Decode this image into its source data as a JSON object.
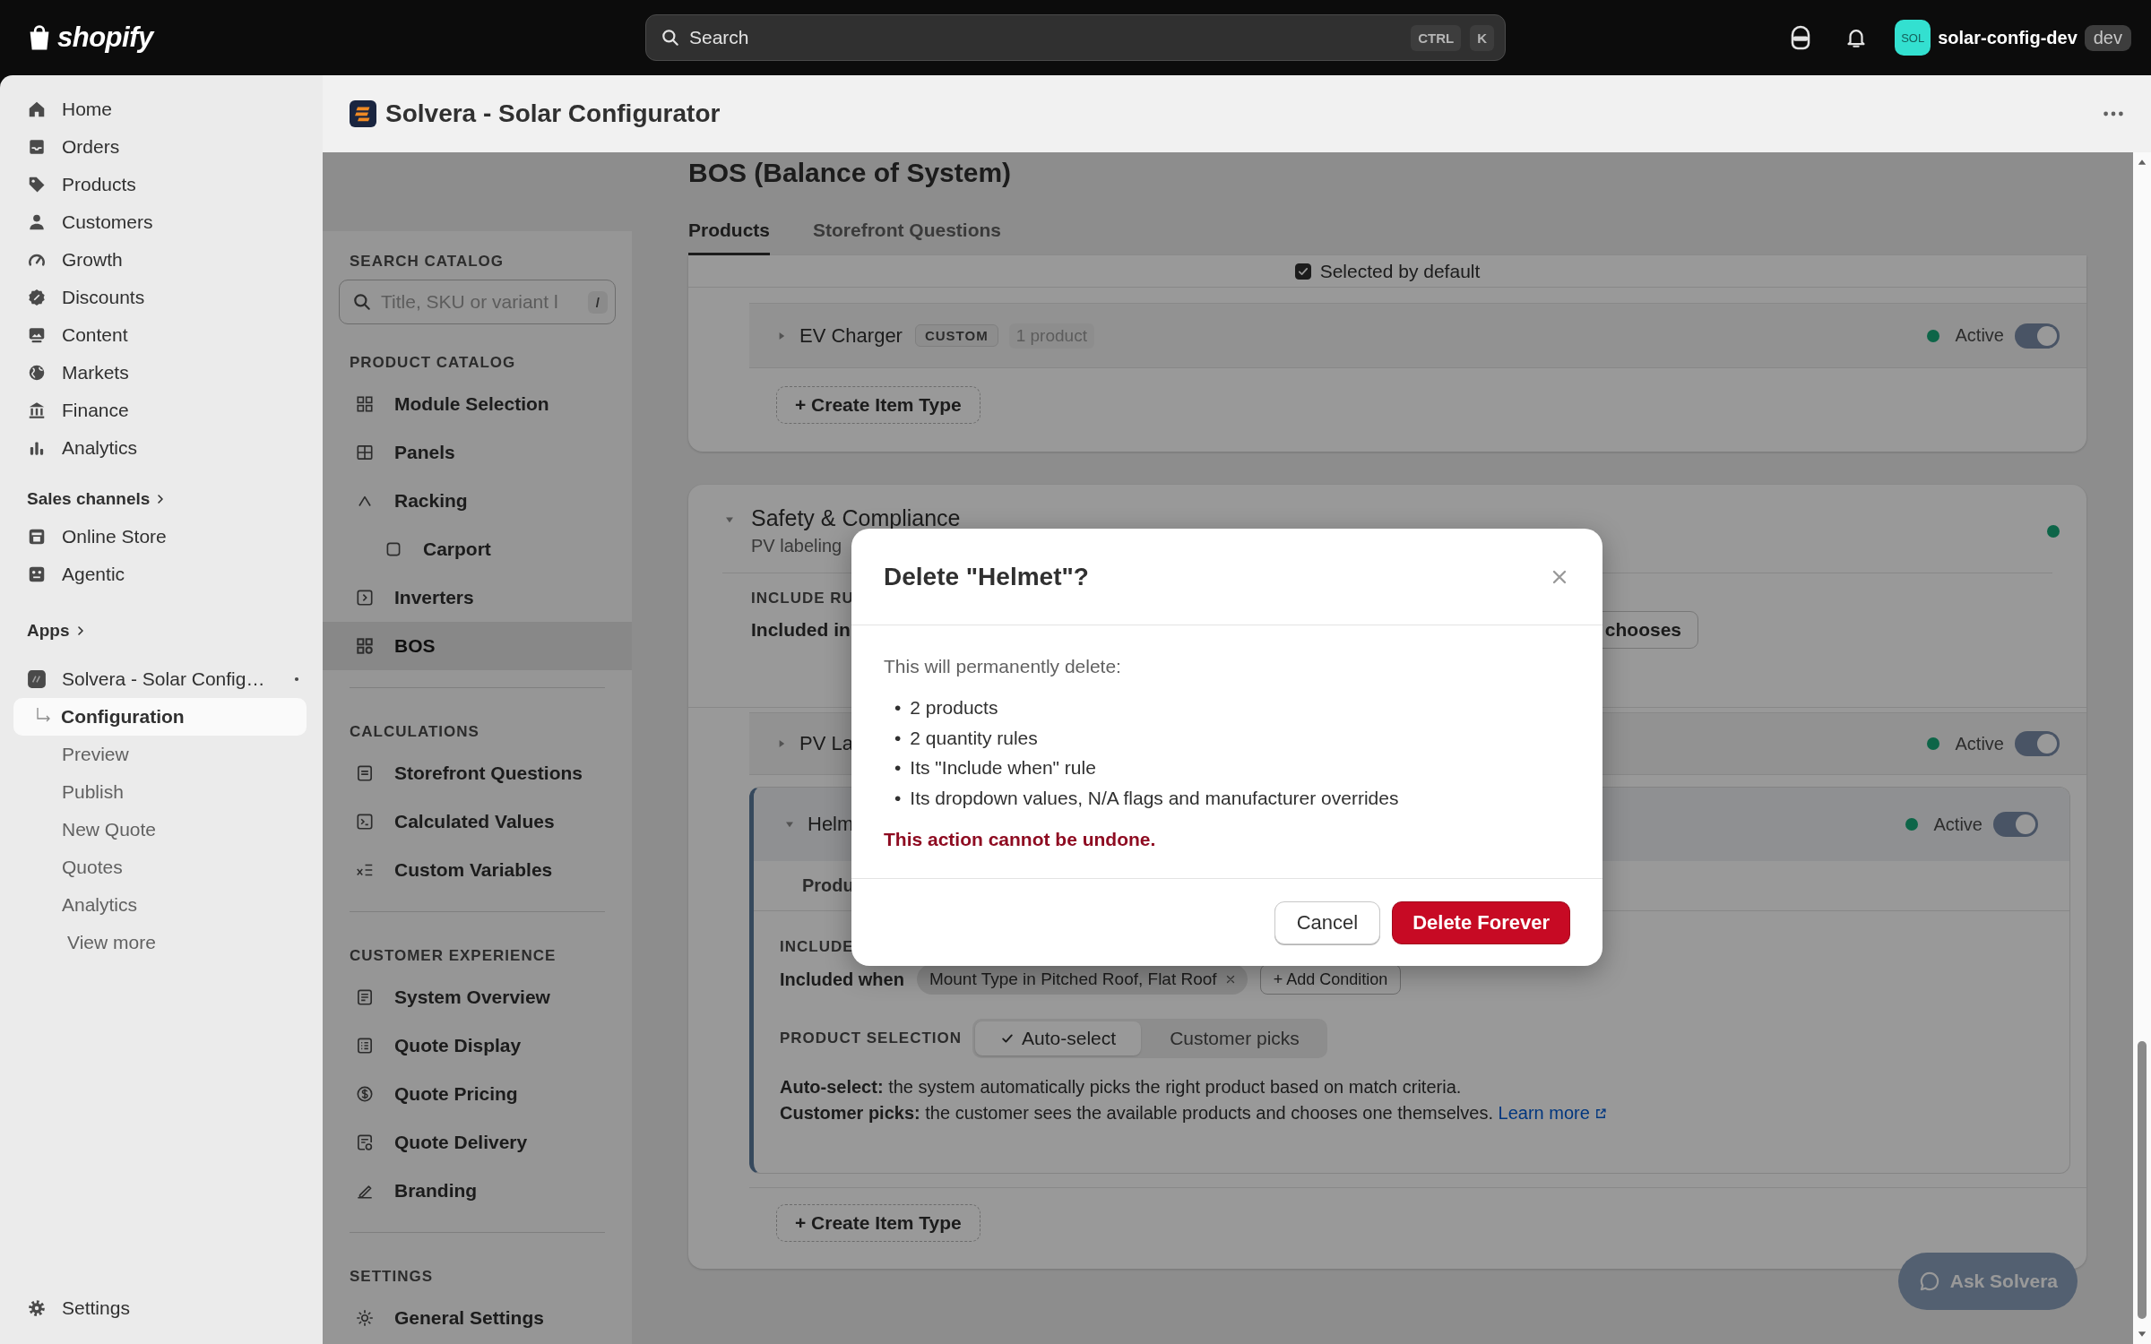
{
  "top_bar": {
    "logo": "shopify",
    "search": {
      "placeholder": "Search",
      "keys": [
        "CTRL",
        "K"
      ]
    },
    "store": {
      "avatar": "SOL",
      "name": "solar-config-dev",
      "badge": "dev"
    }
  },
  "admin_nav": {
    "items": [
      {
        "label": "Home"
      },
      {
        "label": "Orders"
      },
      {
        "label": "Products"
      },
      {
        "label": "Customers"
      },
      {
        "label": "Growth"
      },
      {
        "label": "Discounts"
      },
      {
        "label": "Content"
      },
      {
        "label": "Markets"
      },
      {
        "label": "Finance"
      },
      {
        "label": "Analytics"
      }
    ],
    "sales_channels": {
      "label": "Sales channels",
      "items": [
        {
          "label": "Online Store"
        },
        {
          "label": "Agentic"
        }
      ]
    },
    "apps": {
      "label": "Apps",
      "app": {
        "label": "Solvera - Solar Config…",
        "pages": [
          {
            "label": "Configuration",
            "selected": true
          },
          {
            "label": "Preview",
            "selected": false
          },
          {
            "label": "Publish",
            "selected": false
          },
          {
            "label": "New Quote",
            "selected": false
          },
          {
            "label": "Quotes",
            "selected": false
          },
          {
            "label": "Analytics",
            "selected": false
          }
        ]
      },
      "view_more": "View more"
    },
    "settings": "Settings"
  },
  "app_header": {
    "title": "Solvera - Solar Configurator"
  },
  "catalog_sidebar": {
    "search": {
      "label": "SEARCH CATALOG",
      "placeholder": "Title, SKU or variant l",
      "shortcut": "/"
    },
    "sections": [
      {
        "title": "PRODUCT CATALOG",
        "items": [
          {
            "label": "Module Selection",
            "selected": false
          },
          {
            "label": "Panels",
            "selected": false
          },
          {
            "label": "Racking",
            "selected": false,
            "children": [
              {
                "label": "Carport",
                "selected": false
              }
            ]
          },
          {
            "label": "Inverters",
            "selected": false
          },
          {
            "label": "BOS",
            "selected": true
          }
        ]
      },
      {
        "title": "CALCULATIONS",
        "items": [
          {
            "label": "Storefront Questions",
            "selected": false
          },
          {
            "label": "Calculated Values",
            "selected": false
          },
          {
            "label": "Custom Variables",
            "selected": false
          }
        ]
      },
      {
        "title": "CUSTOMER EXPERIENCE",
        "items": [
          {
            "label": "System Overview",
            "selected": false
          },
          {
            "label": "Quote Display",
            "selected": false
          },
          {
            "label": "Quote Pricing",
            "selected": false
          },
          {
            "label": "Quote Delivery",
            "selected": false
          },
          {
            "label": "Branding",
            "selected": false
          }
        ]
      },
      {
        "title": "SETTINGS",
        "items": [
          {
            "label": "General Settings",
            "selected": false
          }
        ]
      }
    ]
  },
  "main": {
    "title": "BOS (Balance of System)",
    "tabs": [
      {
        "label": "Products",
        "selected": true
      },
      {
        "label": "Storefront Questions",
        "selected": false
      }
    ],
    "groups": [
      {
        "option": {
          "label": "Selected by default",
          "checked": true
        },
        "item_types": [
          {
            "name": "EV Charger",
            "badge": "CUSTOM",
            "count": "1 product",
            "expanded": false,
            "active": true,
            "status": "Active"
          }
        ],
        "create_button": "+ Create Item Type"
      },
      {
        "title": "Safety & Compliance",
        "subtitle": "PV labeling",
        "expanded": true,
        "active": true,
        "include_rule": {
          "label": "INCLUDE RU",
          "text": "Included in",
          "button": "chooses"
        },
        "item_types": [
          {
            "name": "PV La",
            "expanded": false,
            "active": true,
            "status": "Active"
          },
          {
            "name": "Helm",
            "expanded": true,
            "active": true,
            "status": "Active",
            "tab": "Produ",
            "include": {
              "label": "INCLUDE",
              "text": "Included when",
              "chips": [
                {
                  "label": "Mount Type in Pitched Roof, Flat Roof"
                }
              ],
              "add": "+ Add Condition"
            },
            "product_selection": {
              "label": "PRODUCT SELECTION",
              "options": [
                {
                  "label": "Auto-select",
                  "selected": true
                },
                {
                  "label": "Customer picks",
                  "selected": false
                }
              ]
            },
            "help": [
              {
                "text": "**Auto-select:** the system automatically picks the right product based on match criteria."
              },
              {
                "text": "**Customer picks:** the customer sees the available products and chooses one themselves.",
                "link": "Learn more"
              }
            ]
          }
        ],
        "create_button": "+ Create Item Type"
      }
    ]
  },
  "ask_button": "Ask Solvera",
  "dialog": {
    "title": "Delete \"Helmet\"?",
    "intro": "This will permanently delete:",
    "bullet": "•",
    "items": [
      "2 products",
      "2 quantity rules",
      "Its \"Include when\" rule",
      "Its dropdown values, N/A flags and manufacturer overrides"
    ],
    "warning": "This action cannot be undone.",
    "buttons": [
      {
        "label": "Cancel",
        "kind": "secondary"
      },
      {
        "label": "Delete Forever",
        "kind": "danger"
      }
    ]
  }
}
